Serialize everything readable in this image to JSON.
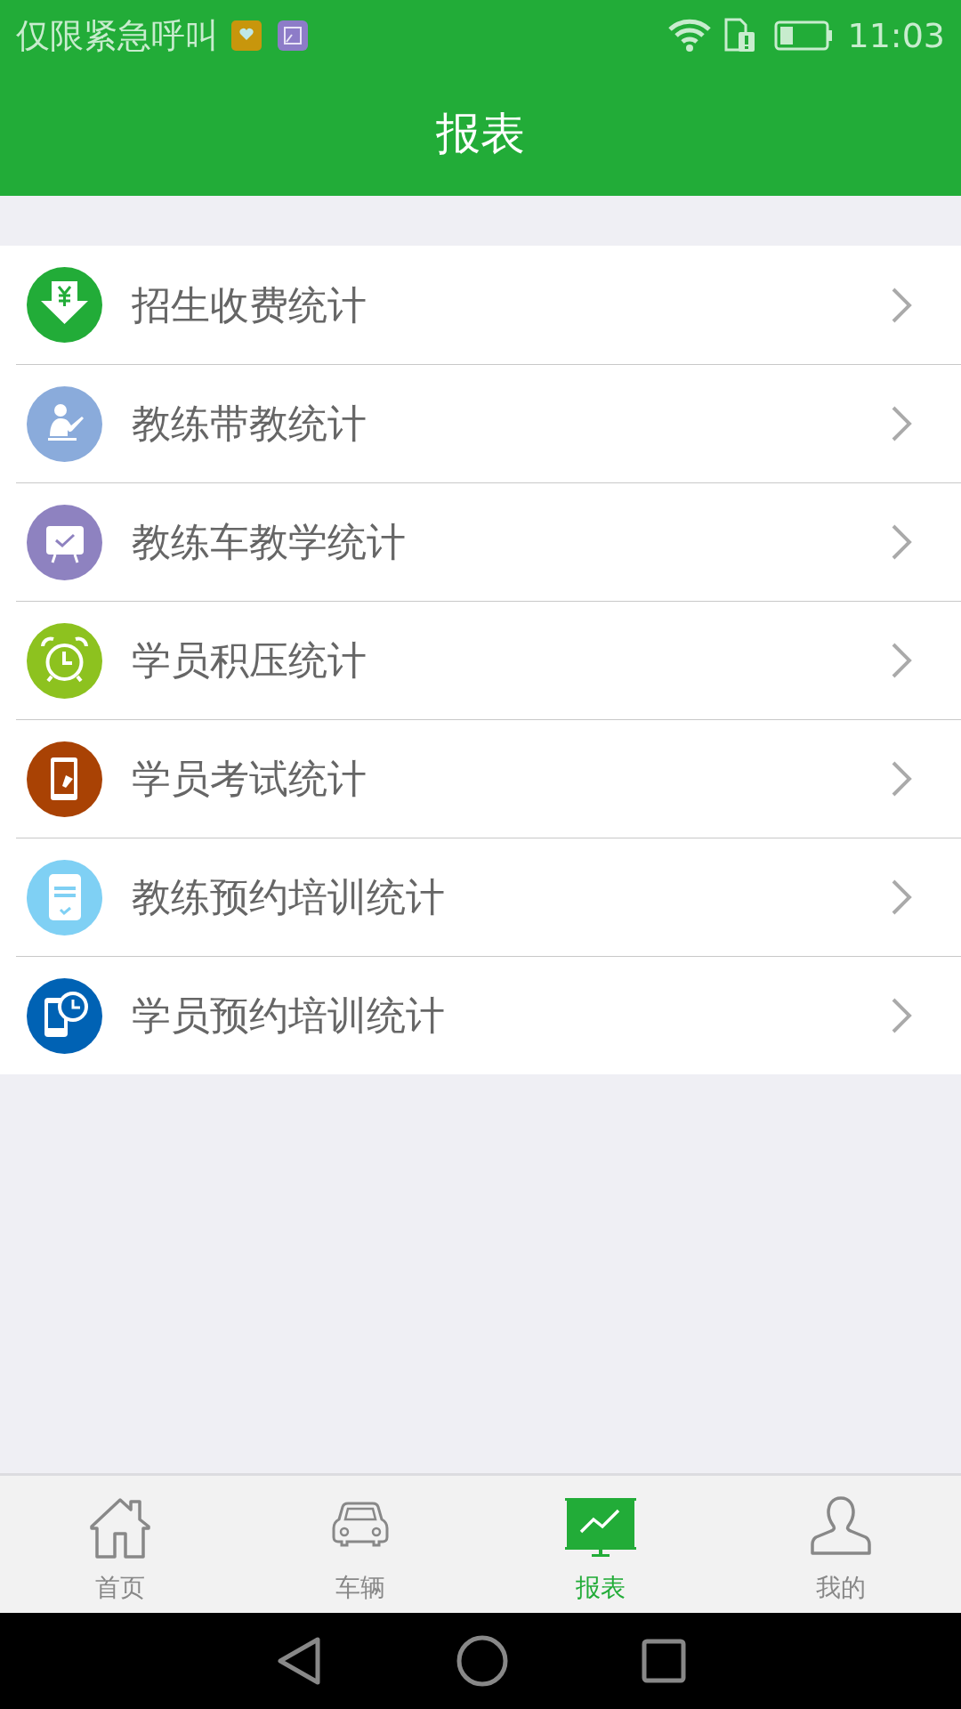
{
  "status_bar": {
    "carrier": "仅限紧急呼叫",
    "time": "11:03"
  },
  "header": {
    "title": "报表"
  },
  "reports": [
    {
      "label": "招生收费统计",
      "color": "#22ac38"
    },
    {
      "label": "教练带教统计",
      "color": "#8aabdb"
    },
    {
      "label": "教练车教学统计",
      "color": "#8e82c0"
    },
    {
      "label": "学员积压统计",
      "color": "#8dc21f"
    },
    {
      "label": "学员考试统计",
      "color": "#a94204"
    },
    {
      "label": "教练预约培训统计",
      "color": "#7fd0f4"
    },
    {
      "label": "学员预约培训统计",
      "color": "#0062b4"
    }
  ],
  "tabs": [
    {
      "label": "首页",
      "selected": false
    },
    {
      "label": "车辆",
      "selected": false
    },
    {
      "label": "报表",
      "selected": true
    },
    {
      "label": "我的",
      "selected": false
    }
  ]
}
